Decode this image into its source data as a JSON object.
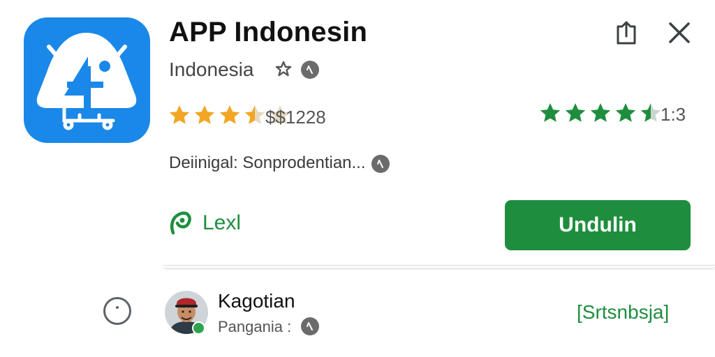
{
  "app": {
    "title": "APP Indonesin",
    "developer": "Indonesia",
    "price": "$$1228",
    "score": "1:3",
    "description": "Deiinigal: Sonprodentian...",
    "link_label": "Lexl",
    "install_label": "Undulin",
    "icon": {
      "name": "app-logo-icon",
      "bg_color": "#1a88e8",
      "fg_color": "#ffffff"
    },
    "rating_left": 3.5,
    "rating_right": 4.5
  },
  "review": {
    "reviewer_name": "Kagotian",
    "reviewer_sub": "Pangania :",
    "subscribe_label": "[Srtsnbsja]"
  },
  "icons": [
    "share-icon",
    "close-icon",
    "verified-star-icon",
    "info-icon",
    "link-leaf-icon",
    "radio-icon",
    "avatar-photo"
  ],
  "colors": {
    "accent_green": "#1e8e3e",
    "star_orange": "#f2a623",
    "star_green": "#1e8e3e",
    "app_blue": "#1a88e8"
  }
}
